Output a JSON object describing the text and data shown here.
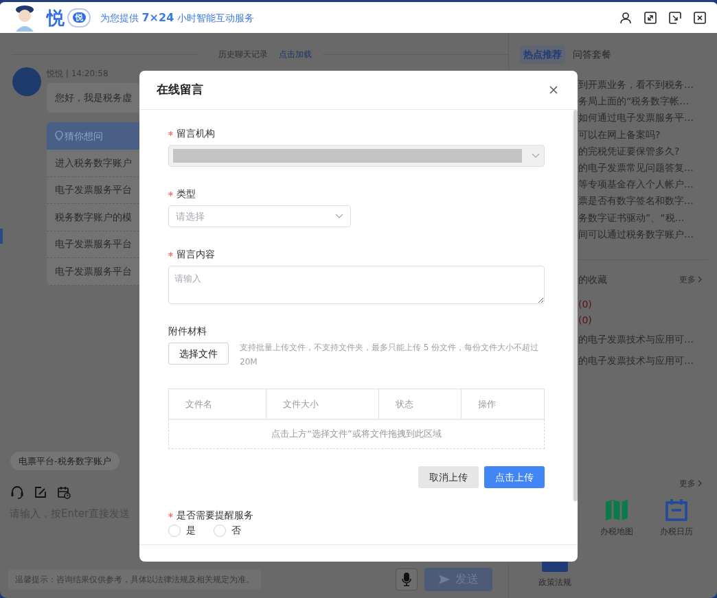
{
  "header": {
    "logo_text": "悦",
    "badge_text": "悦",
    "slogan": "为您提供 **7×24** 小时智能互动服务"
  },
  "chat": {
    "history_label": "历史聊天记录",
    "history_link": "点击加载",
    "messages": [
      {
        "sender": "悦悦 | 14:20:58",
        "text": "您好，我是税务虚"
      }
    ],
    "suggest": {
      "title": "猜你想问",
      "items": [
        "进入税务数字账户",
        "电子发票服务平台",
        "税务数字账户的模",
        "电子发票服务平台",
        "电子发票服务平台"
      ]
    },
    "quick_tags": [
      "电票平台-税务数字账户"
    ],
    "input": {
      "placeholder": "请输入，按Enter直接发送"
    },
    "tip": "温馨提示：咨询结果仅供参考，具体以法律法规及相关规定为准。",
    "send_button": {
      "label": "发送",
      "disabled": true
    }
  },
  "side_panel": {
    "tabs": [
      {
        "label": "热点推荐",
        "selected": true
      },
      {
        "label": "问答套餐",
        "selected": false
      }
    ],
    "hot_items": [
      "到开票业务，看不到税务…",
      "务局上面的“税务数字帐…",
      "如何通过电子发票服务平…",
      "可以在网上备案吗?",
      "的完税凭证要保管多久?",
      "的电子发票常见问题答复…",
      "等专项基金存入个人帐户…",
      "票是否有数字签名和数字…",
      "务数字证书驱动”、“税…",
      "间可以通过税务数字账户…"
    ],
    "favorites": {
      "title": "的收藏",
      "more": "更多",
      "counts": [
        "(0)",
        "(0)"
      ],
      "items": [
        "的电子发票技术与应用可…",
        "的电子发票技术与应用可…"
      ]
    },
    "services": {
      "more": "更多",
      "items": [
        {
          "label": "办税地图",
          "kind": "map"
        },
        {
          "label": "办税日历",
          "kind": "calendar"
        },
        {
          "label": "政策法规",
          "kind": "policy"
        }
      ]
    }
  },
  "dialog": {
    "title": "在线留言",
    "fields": [
      {
        "kind": "select",
        "label": "留言机构",
        "required": true,
        "disabled": true,
        "redacted": true
      },
      {
        "kind": "select",
        "label": "类型",
        "required": true,
        "disabled": false,
        "placeholder": "请选择"
      },
      {
        "kind": "textarea",
        "label": "留言内容",
        "required": true,
        "placeholder": "请输入"
      },
      {
        "kind": "upload",
        "label": "附件材料",
        "required": false,
        "button": "选择文件",
        "hint": "支持批量上传文件，不支持文件夹，最多只能上传 5 份文件，每份文件大小不超过 20M",
        "columns": [
          "文件名",
          "文件大小",
          "状态",
          "操作"
        ],
        "empty_text": "点击上方“选择文件”或将文件拖拽到此区域",
        "actions": [
          {
            "label": "取消上传",
            "kind": "secondary"
          },
          {
            "label": "点击上传",
            "kind": "primary"
          }
        ]
      },
      {
        "kind": "radio",
        "label": "是否需要提醒服务",
        "required": true,
        "options": [
          {
            "label": "是",
            "selected": false
          },
          {
            "label": "否",
            "selected": false
          }
        ]
      }
    ]
  }
}
